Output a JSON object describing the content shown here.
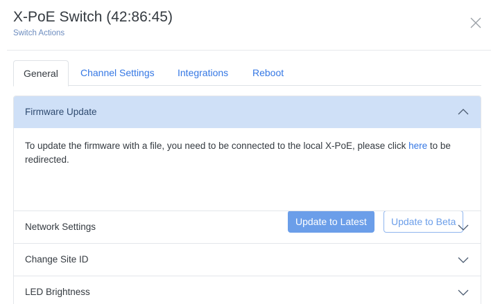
{
  "modal": {
    "title": "X-PoE Switch (42:86:45)",
    "subtitle": "Switch Actions",
    "close_icon": "close-icon"
  },
  "tabs": [
    {
      "label": "General",
      "active": true
    },
    {
      "label": "Channel Settings",
      "active": false
    },
    {
      "label": "Integrations",
      "active": false
    },
    {
      "label": "Reboot",
      "active": false
    }
  ],
  "accordion": {
    "firmware": {
      "title": "Firmware Update",
      "expanded": true,
      "text_before_link": "To update the firmware with a file, you need to be connected to the local X-PoE, please click ",
      "link_text": "here",
      "text_after_link": " to be redirected.",
      "update_latest_label": "Update to Latest",
      "update_beta_label": "Update to Beta"
    },
    "network": {
      "title": "Network Settings",
      "expanded": false
    },
    "site_id": {
      "title": "Change Site ID",
      "expanded": false
    },
    "led": {
      "title": "LED Brightness",
      "expanded": false
    }
  },
  "colors": {
    "accent": "#3477e4",
    "open_header_bg": "#cfe0f7",
    "primary_button": "#6b9ee9"
  }
}
